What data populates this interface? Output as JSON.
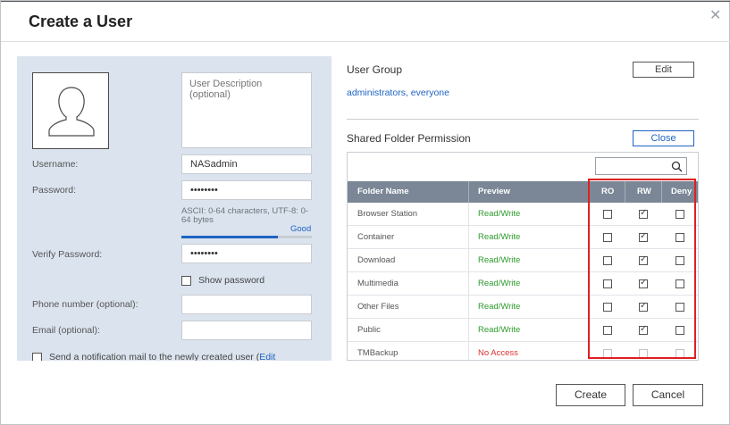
{
  "dialog": {
    "title": "Create a User"
  },
  "form": {
    "description_placeholder": "User Description (optional)",
    "username_label": "Username:",
    "username_value": "NASadmin",
    "password_label": "Password:",
    "password_value": "••••••••",
    "password_hint": "ASCII: 0-64 characters, UTF-8: 0-64 bytes",
    "strength_label": "Good",
    "strength_level": 0.74,
    "verify_label": "Verify Password:",
    "verify_value": "••••••••",
    "show_password_label": "Show password",
    "phone_label": "Phone number (optional):",
    "email_label": "Email (optional):",
    "notify_label": "Send a notification mail to the newly created user (",
    "notify_edit": "Edit"
  },
  "user_group": {
    "title": "User Group",
    "edit_button": "Edit",
    "groups": "administrators, everyone"
  },
  "shared_folders": {
    "title": "Shared Folder Permission",
    "close_button": "Close",
    "search_icon": "search-icon",
    "columns": [
      "Folder Name",
      "Preview",
      "RO",
      "RW",
      "Deny"
    ],
    "rows": [
      {
        "name": "Browser Station",
        "preview": "Read/Write",
        "ro": false,
        "rw": true,
        "deny": false
      },
      {
        "name": "Container",
        "preview": "Read/Write",
        "ro": false,
        "rw": true,
        "deny": false
      },
      {
        "name": "Download",
        "preview": "Read/Write",
        "ro": false,
        "rw": true,
        "deny": false
      },
      {
        "name": "Multimedia",
        "preview": "Read/Write",
        "ro": false,
        "rw": true,
        "deny": false
      },
      {
        "name": "Other Files",
        "preview": "Read/Write",
        "ro": false,
        "rw": true,
        "deny": false
      },
      {
        "name": "Public",
        "preview": "Read/Write",
        "ro": false,
        "rw": true,
        "deny": false
      },
      {
        "name": "TMBackup",
        "preview": "No Access",
        "ro": false,
        "rw": false,
        "deny": false,
        "disabled": true
      }
    ]
  },
  "footer": {
    "create_button": "Create",
    "cancel_button": "Cancel"
  },
  "colors": {
    "read_write": "#2e9a2e",
    "no_access": "#d93030",
    "link": "#1f63c2",
    "highlight": "#e02020"
  }
}
